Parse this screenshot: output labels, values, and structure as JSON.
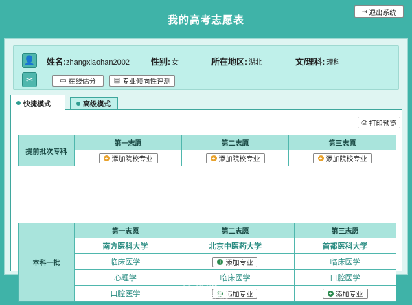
{
  "header": {
    "title": "我的高考志愿表",
    "logout_label": "退出系统"
  },
  "user": {
    "name_label": "姓名:",
    "name_value": "zhangxiaohan2002",
    "gender_label": "性别:",
    "gender_value": "女",
    "region_label": "所在地区:",
    "region_value": "湖北",
    "track_label": "文/理科:",
    "track_value": "理科"
  },
  "actions": {
    "estimate_label": "在线估分",
    "aptitude_label": "专业倾向性评测"
  },
  "tabs": [
    {
      "label": "快捷模式"
    },
    {
      "label": "高级模式"
    }
  ],
  "toolbar": {
    "print_label": "打印预览"
  },
  "table_early": {
    "row_label": "提前批次专科",
    "columns": [
      "第一志愿",
      "第二志愿",
      "第三志愿"
    ],
    "add_label": "添加院校专业"
  },
  "table_tier1": {
    "row_label": "本科一批",
    "columns": [
      "第一志愿",
      "第二志愿",
      "第三志愿"
    ],
    "universities": [
      "南方医科大学",
      "北京中医药大学",
      "首都医科大学"
    ],
    "rows": [
      [
        "临床医学",
        "",
        "临床医学"
      ],
      [
        "心理学",
        "临床医学",
        "口腔医学"
      ],
      [
        "口腔医学",
        "",
        ""
      ]
    ],
    "add_label": "添加专业"
  },
  "footer": {
    "brand_en": "AliHealth",
    "brand_cn": "阿里健康"
  },
  "colors": {
    "background": "#3fb3a8",
    "panel": "#bff0ea",
    "header_cell": "#a9e4dc",
    "accent_text": "#2a8c82"
  },
  "icons": [
    "exit-icon",
    "user-avatar-icon",
    "tools-icon",
    "calculator-icon",
    "book-icon",
    "printer-icon",
    "plus-circle-icon",
    "alihealth-logo"
  ]
}
